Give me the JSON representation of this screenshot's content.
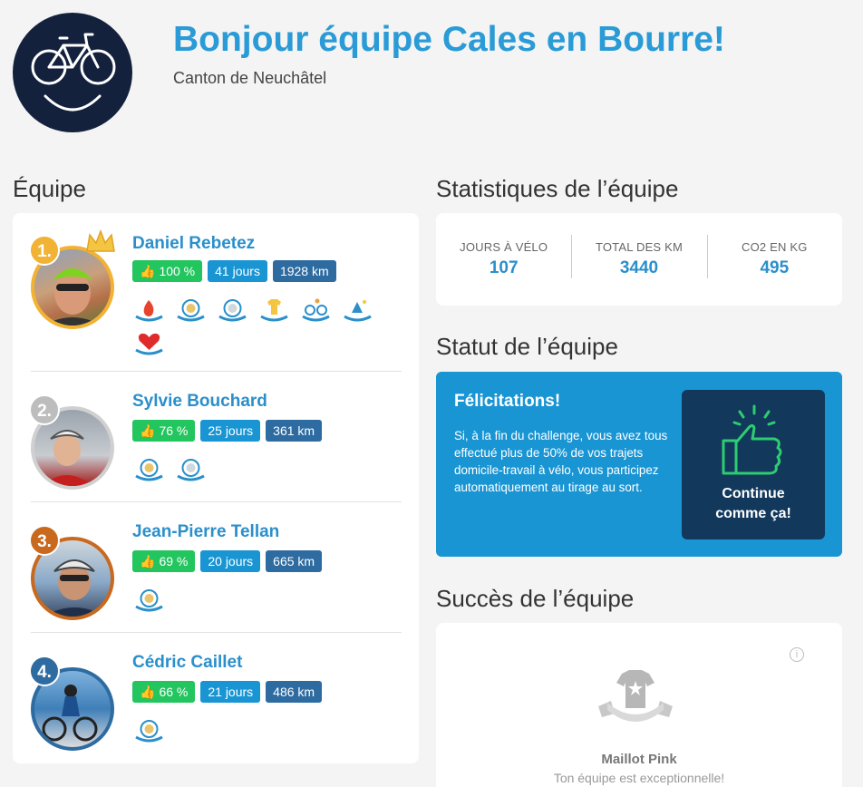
{
  "header": {
    "title": "Bonjour équipe Cales en Bourre!",
    "subtitle": "Canton de Neuchâtel"
  },
  "team": {
    "section_title": "Équipe",
    "members": [
      {
        "rank": "1.",
        "name": "Daniel Rebetez",
        "percent": "100 %",
        "days": "41 jours",
        "km": "1928 km",
        "rank_color": "#f2b233"
      },
      {
        "rank": "2.",
        "name": "Sylvie Bouchard",
        "percent": "76 %",
        "days": "25 jours",
        "km": "361 km",
        "rank_color": "#bdbdbd"
      },
      {
        "rank": "3.",
        "name": "Jean-Pierre Tellan",
        "percent": "69 %",
        "days": "20 jours",
        "km": "665 km",
        "rank_color": "#c8691e"
      },
      {
        "rank": "4.",
        "name": "Cédric Caillet",
        "percent": "66 %",
        "days": "21 jours",
        "km": "486 km",
        "rank_color": "#2d6ba1"
      }
    ]
  },
  "stats": {
    "section_title": "Statistiques de l’équipe",
    "items": [
      {
        "label": "JOURS À VÉLO",
        "value": "107"
      },
      {
        "label": "TOTAL DES KM",
        "value": "3440"
      },
      {
        "label": "CO2 EN KG",
        "value": "495"
      }
    ]
  },
  "status": {
    "section_title": "Statut de l’équipe",
    "title": "Félicitations!",
    "text": "Si, à la fin du challenge, vous avez tous effectué plus de 50% de vos trajets domicile-travail à vélo, vous participez automatiquement au tirage au sort.",
    "box_label": "Continue comme ça!"
  },
  "success": {
    "section_title": "Succès de l’équipe",
    "badge_name": "Maillot Pink",
    "badge_desc": "Ton équipe est exceptionnelle!",
    "info_icon": "i"
  },
  "colors": {
    "accent": "#2a9bd6",
    "green": "#22c55e",
    "status_bg": "#1a95d3",
    "status_box": "#12385c"
  }
}
